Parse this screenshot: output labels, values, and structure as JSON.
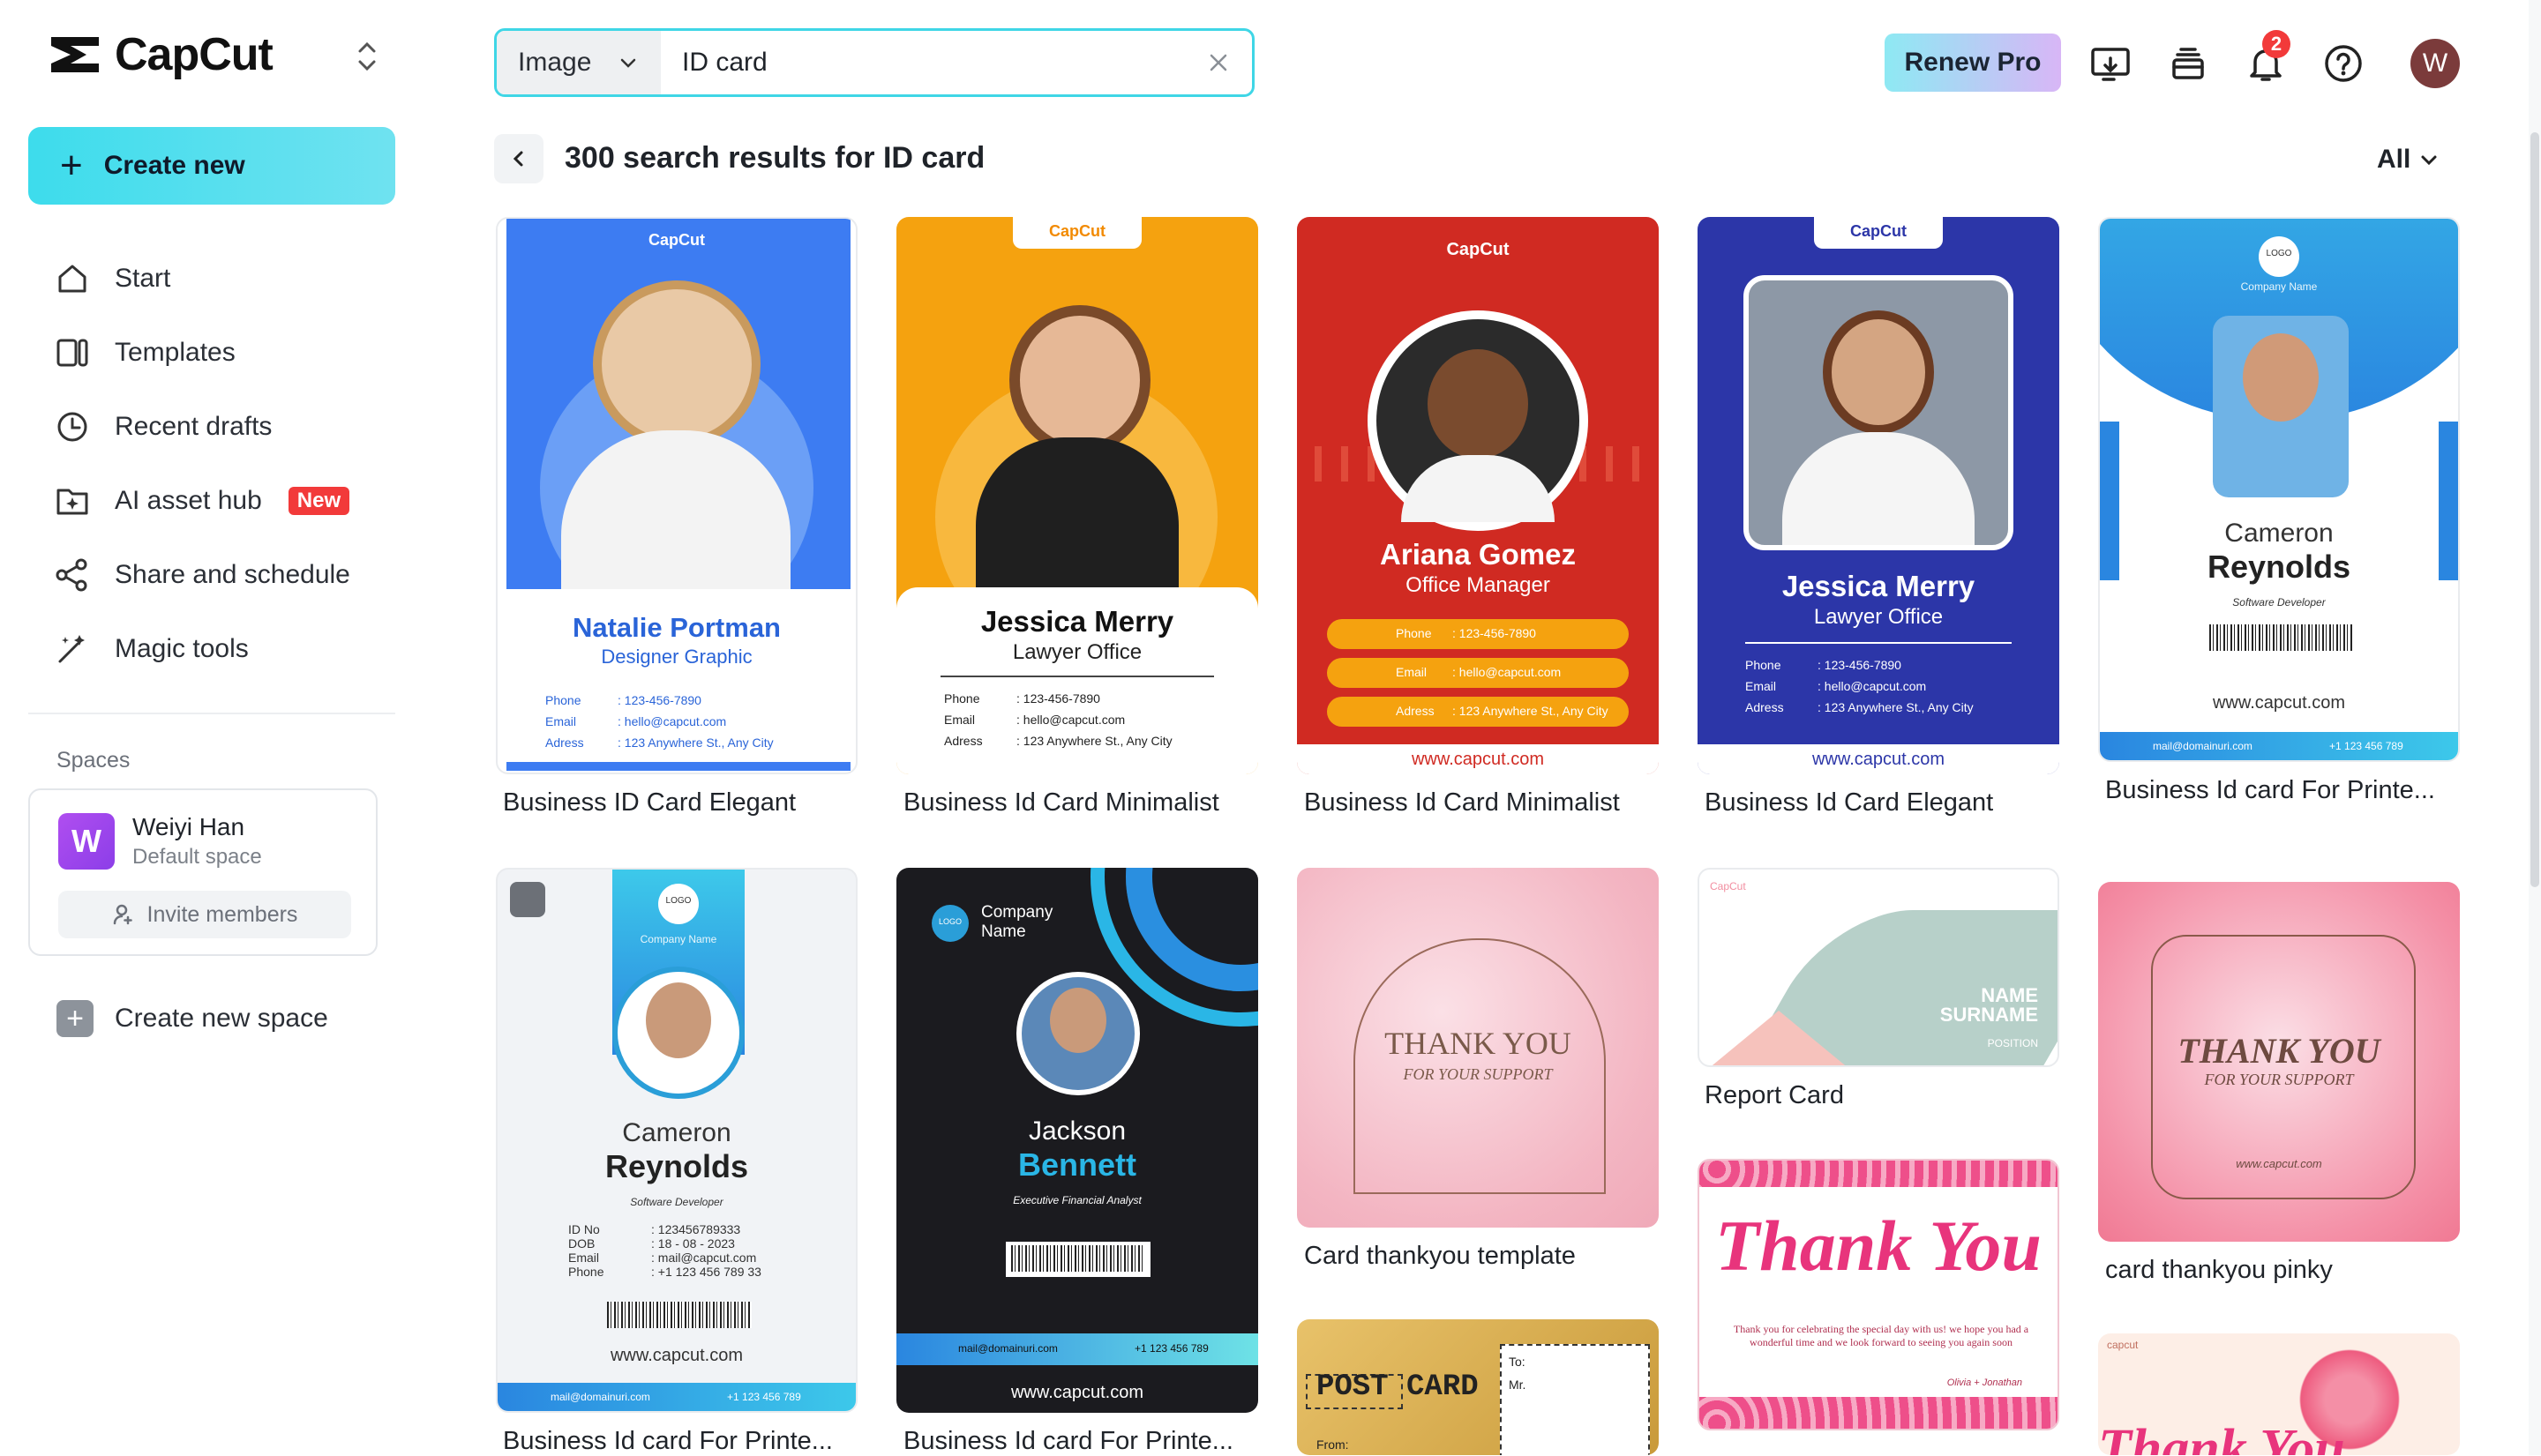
{
  "app": {
    "name": "CapCut"
  },
  "sidebar": {
    "create_label": "Create new",
    "items": [
      {
        "label": "Start",
        "icon": "home-icon"
      },
      {
        "label": "Templates",
        "icon": "templates-icon"
      },
      {
        "label": "Recent drafts",
        "icon": "clock-icon"
      },
      {
        "label": "AI asset hub",
        "icon": "ai-asset-icon",
        "badge": "New"
      },
      {
        "label": "Share and schedule",
        "icon": "share-icon"
      },
      {
        "label": "Magic tools",
        "icon": "magic-wand-icon"
      }
    ],
    "spaces_label": "Spaces",
    "space": {
      "initial": "W",
      "name": "Weiyi Han",
      "sub": "Default space",
      "invite_label": "Invite members"
    },
    "new_space_label": "Create new space"
  },
  "search": {
    "type": "Image",
    "value": "ID card"
  },
  "topbar": {
    "renew_label": "Renew Pro",
    "notifications": "2",
    "user_initial": "W"
  },
  "results": {
    "title": "300 search results for ID card",
    "filter": "All"
  },
  "cards": [
    {
      "caption": "Business ID Card Elegant",
      "name": "Natalie Portman",
      "role": "Designer Graphic",
      "brand": "CapCut",
      "phone": "Phone",
      "phone_v": ": 123-456-7890",
      "email": "Email",
      "email_v": ": hello@capcut.com",
      "addr": "Adress",
      "addr_v": ": 123 Anywhere St., Any City"
    },
    {
      "caption": "Business Id Card Minimalist",
      "name": "Jessica Merry",
      "role": "Lawyer Office",
      "brand": "CapCut",
      "phone": "Phone",
      "phone_v": ": 123-456-7890",
      "email": "Email",
      "email_v": ": hello@capcut.com",
      "addr": "Adress",
      "addr_v": ": 123 Anywhere St., Any City"
    },
    {
      "caption": "Business Id Card Minimalist",
      "name": "Ariana Gomez",
      "role": "Office Manager",
      "brand": "CapCut",
      "phone": "Phone",
      "phone_v": ": 123-456-7890",
      "email": "Email",
      "email_v": ": hello@capcut.com",
      "addr": "Adress",
      "addr_v": ": 123 Anywhere St., Any City",
      "web": "www.capcut.com"
    },
    {
      "caption": "Business Id Card Elegant",
      "name": "Jessica Merry",
      "role": "Lawyer Office",
      "brand": "CapCut",
      "phone": "Phone",
      "phone_v": ": 123-456-7890",
      "email": "Email",
      "email_v": ": hello@capcut.com",
      "addr": "Adress",
      "addr_v": ": 123 Anywhere St., Any City",
      "web": "www.capcut.com"
    },
    {
      "caption": "Business Id card For Printe...",
      "logo": "LOGO",
      "company": "Company Name",
      "first": "Cameron",
      "last": "Reynolds",
      "role": "Software Developer",
      "web": "www.capcut.com",
      "mail": "mail@domainuri.com",
      "tel": "+1 123 456 789"
    },
    {
      "caption": "Business Id card For Printe...",
      "logo": "LOGO",
      "company": "Company Name",
      "first": "Cameron",
      "last": "Reynolds",
      "role": "Software Developer",
      "id_l": "ID No",
      "id_v": ": 123456789333",
      "dob_l": "DOB",
      "dob_v": ": 18 - 08 - 2023",
      "email_l": "Email",
      "email_v": ": mail@capcut.com",
      "phone_l": "Phone",
      "phone_v": ": +1 123 456 789 33",
      "web": "www.capcut.com",
      "mail": "mail@domainuri.com",
      "tel": "+1 123 456 789"
    },
    {
      "caption": "Business Id card For Printe...",
      "logo": "LOGO",
      "company1": "Company",
      "company2": "Name",
      "first": "Jackson",
      "last": "Bennett",
      "role": "Executive Financial Analyst",
      "web": "www.capcut.com",
      "mail": "mail@domainuri.com",
      "tel": "+1 123 456 789"
    },
    {
      "caption": "Card thankyou template",
      "big": "THANK YOU",
      "small": "FOR YOUR SUPPORT"
    },
    {
      "caption": "Report Card",
      "brand": "CapCut",
      "name1": "NAME",
      "name2": "SURNAME",
      "position": "POSITION"
    },
    {
      "caption": "card thankyou pinky",
      "big": "THANK YOU",
      "small": "FOR YOUR SUPPORT",
      "web": "www.capcut.com"
    },
    {
      "caption": "",
      "big": "Thank You",
      "body": "Thank you for celebrating the special day with us! we hope you had a wonderful time and we look forward to seeing you again soon",
      "sign": "Olivia + Jonathan"
    },
    {
      "caption": "",
      "title": "POST CARD",
      "to": "To:",
      "mr": "Mr.",
      "from": "From:"
    },
    {
      "caption": "",
      "brand": "capcut",
      "big": "Thank You"
    }
  ]
}
